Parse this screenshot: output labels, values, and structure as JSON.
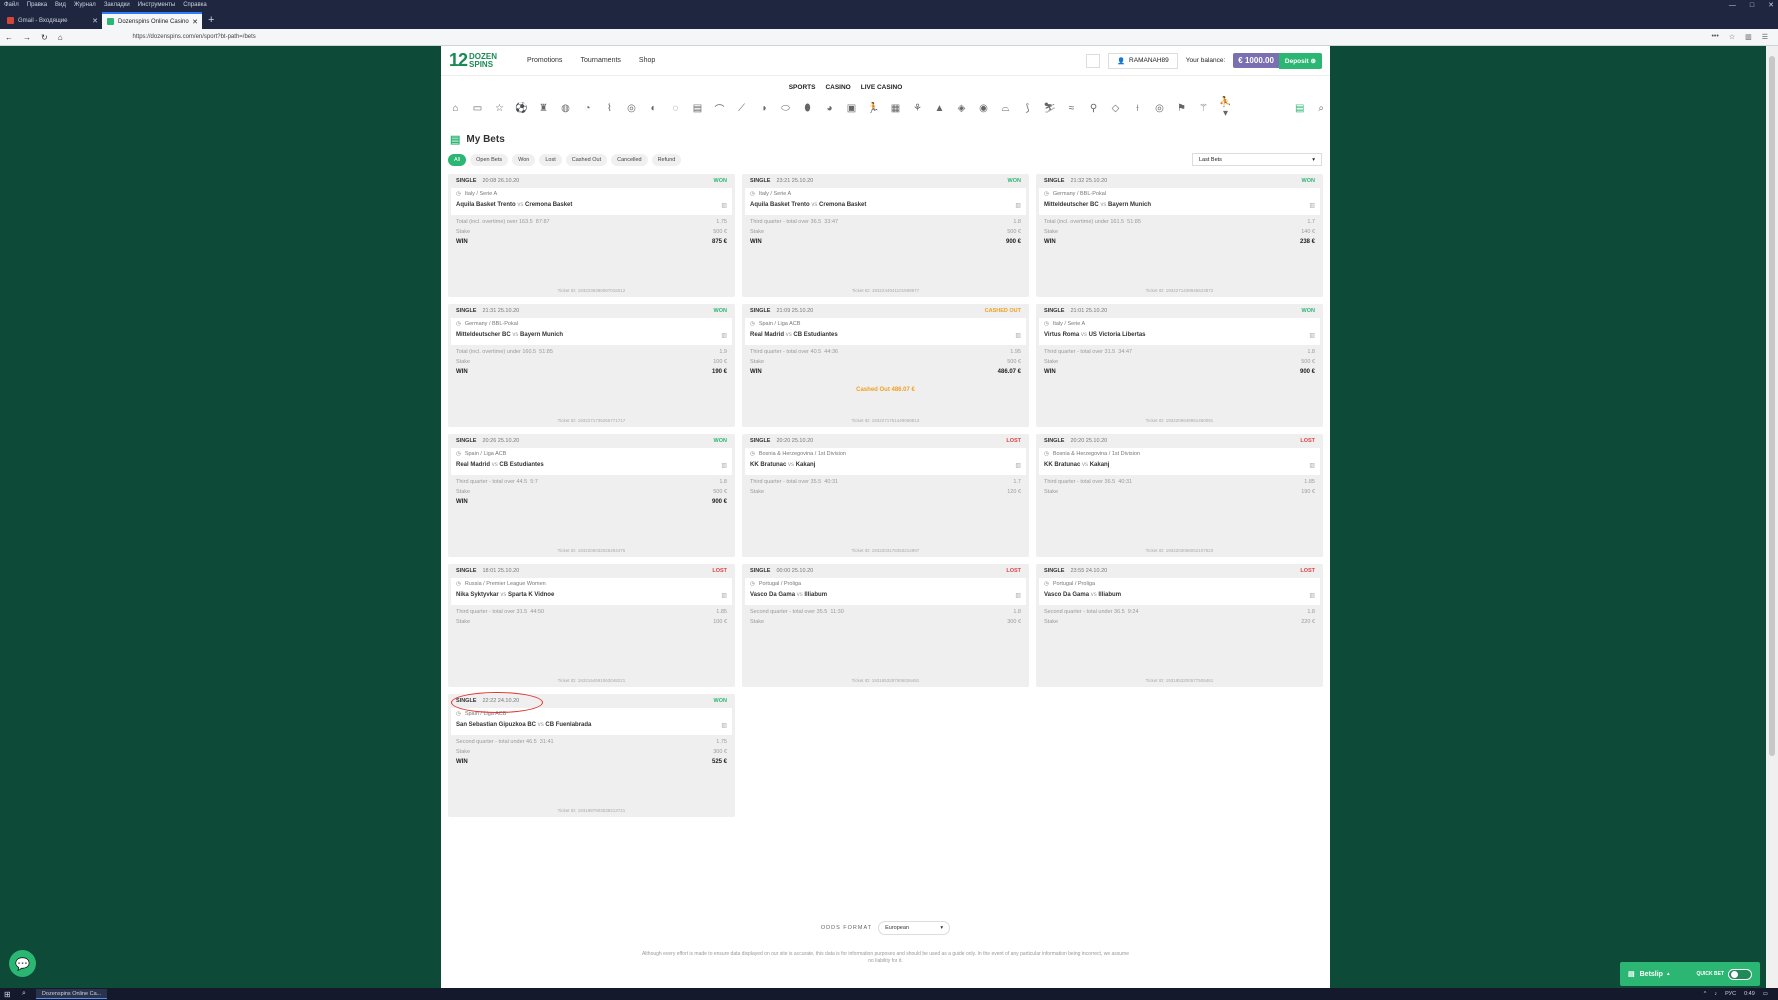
{
  "os": {
    "menu": [
      "Файл",
      "Правка",
      "Вид",
      "Журнал",
      "Закладки",
      "Инструменты",
      "Справка"
    ]
  },
  "browser": {
    "tabs": [
      {
        "label": "Gmail - Входящие",
        "active": false
      },
      {
        "label": "Dozenspins Online Casino",
        "active": true
      }
    ],
    "url": "https://dozenspins.com/en/sport?bt-path=/bets"
  },
  "site": {
    "logo_num": "12",
    "logo_word1": "DOZEN",
    "logo_word2": "SPINS",
    "nav": [
      "Promotions",
      "Tournaments",
      "Shop"
    ],
    "username": "RAMANAH89",
    "balance_label": "Your balance:",
    "balance": "€ 1000.00",
    "deposit": "Deposit"
  },
  "main_tabs": [
    "SPORTS",
    "CASINO",
    "LIVE CASINO"
  ],
  "page_title": "My Bets",
  "filters": [
    "All",
    "Open Bets",
    "Won",
    "Lost",
    "Cashed Out",
    "Cancelled",
    "Refund"
  ],
  "sort_select": "Last Bets",
  "bets": [
    {
      "kind": "SINGLE",
      "time": "20:08 26.10.20",
      "status": "WON",
      "league": "Italy / Serie A",
      "home": "Aquila Basket Trento",
      "away": "Cremona Basket",
      "market": "Total (incl. overtime) over 163.5",
      "stat": "87:87",
      "odds": "1.75",
      "stake_label": "Stake",
      "stake": "500 €",
      "win_label": "WIN",
      "win": "875 €",
      "ticket": "Ticket ID: 1932236380097016012",
      "cash": ""
    },
    {
      "kind": "SINGLE",
      "time": "23:21 25.10.20",
      "status": "WON",
      "league": "Italy / Serie A",
      "home": "Aquila Basket Trento",
      "away": "Cremona Basket",
      "market": "Third quarter - total over 36.5",
      "stat": "33:47",
      "odds": "1.8",
      "stake_label": "Stake",
      "stake": "500 €",
      "win_label": "WIN",
      "win": "900 €",
      "ticket": "Ticket ID: 1932244041101599977",
      "cash": ""
    },
    {
      "kind": "SINGLE",
      "time": "21:32 25.10.20",
      "status": "WON",
      "league": "Germany / BBL-Pokal",
      "home": "Mitteldeutscher BC",
      "away": "Bayern Munich",
      "market": "Total (incl. overtime) under 161.5",
      "stat": "51:85",
      "odds": "1.7",
      "stake_label": "Stake",
      "stake": "140 €",
      "win_label": "WIN",
      "win": "238 €",
      "ticket": "Ticket ID: 1932271439945523872",
      "cash": ""
    },
    {
      "kind": "SINGLE",
      "time": "21:31 25.10.20",
      "status": "WON",
      "league": "Germany / BBL-Pokal",
      "home": "Mitteldeutscher BC",
      "away": "Bayern Munich",
      "market": "Total (incl. overtime) under 160.5",
      "stat": "51:85",
      "odds": "1.9",
      "stake_label": "Stake",
      "stake": "100 €",
      "win_label": "WIN",
      "win": "190 €",
      "ticket": "Ticket ID: 1932271735266771717",
      "cash": ""
    },
    {
      "kind": "SINGLE",
      "time": "21:09 25.10.20",
      "status": "CASHED OUT",
      "league": "Spain / Liga ACB",
      "home": "Real Madrid",
      "away": "CB Estudiantes",
      "market": "Third quarter - total over 40.5",
      "stat": "44:36",
      "odds": "1.95",
      "stake_label": "Stake",
      "stake": "500 €",
      "win_label": "WIN",
      "win": "486.07 €",
      "ticket": "Ticket ID: 1932271751449069813",
      "cash": "Cashed Out 486.07 €"
    },
    {
      "kind": "SINGLE",
      "time": "21:01 25.10.20",
      "status": "WON",
      "league": "Italy / Serie A",
      "home": "Virtus Roma",
      "away": "US Victoria Libertas",
      "market": "Third quarter - total over 31.5",
      "stat": "34:47",
      "odds": "1.8",
      "stake_label": "Stake",
      "stake": "500 €",
      "win_label": "WIN",
      "win": "900 €",
      "ticket": "Ticket ID: 1932209649961460091",
      "cash": ""
    },
    {
      "kind": "SINGLE",
      "time": "20:26 25.10.20",
      "status": "WON",
      "league": "Spain / Liga ACB",
      "home": "Real Madrid",
      "away": "CB Estudiantes",
      "market": "Third quarter - total over 44.5",
      "stat": "5:7",
      "odds": "1.8",
      "stake_label": "Stake",
      "stake": "500 €",
      "win_label": "WIN",
      "win": "900 €",
      "ticket": "Ticket ID: 1932205032025494475",
      "cash": ""
    },
    {
      "kind": "SINGLE",
      "time": "20:20 25.10.20",
      "status": "LOST",
      "league": "Bosnia & Herzegovina / 1st Division",
      "home": "KK Bratunac",
      "away": "Kakanj",
      "market": "Third quarter - total over 35.5",
      "stat": "40:31",
      "odds": "1.7",
      "stake_label": "Stake",
      "stake": "120 €",
      "win_label": "",
      "win": "",
      "ticket": "Ticket ID: 1932203178353214997",
      "cash": ""
    },
    {
      "kind": "SINGLE",
      "time": "20:20 25.10.20",
      "status": "LOST",
      "league": "Bosnia & Herzegovina / 1st Division",
      "home": "KK Bratunac",
      "away": "Kakanj",
      "market": "Third quarter - total over 36.5",
      "stat": "40:31",
      "odds": "1.85",
      "stake_label": "Stake",
      "stake": "190 €",
      "win_label": "",
      "win": "",
      "ticket": "Ticket ID: 1932203066052107623",
      "cash": ""
    },
    {
      "kind": "SINGLE",
      "time": "18:01 25.10.20",
      "status": "LOST",
      "league": "Russia / Premier League Women",
      "home": "Nika Syktyvkar",
      "away": "Sparta K Vidnoe",
      "market": "Third quarter - total over 31.5",
      "stat": "44:50",
      "odds": "1.85",
      "stake_label": "Stake",
      "stake": "100 €",
      "win_label": "",
      "win": "",
      "ticket": "Ticket ID: 1932164591063048221",
      "cash": ""
    },
    {
      "kind": "SINGLE",
      "time": "00:00 25.10.20",
      "status": "LOST",
      "league": "Portugal / Proliga",
      "home": "Vasco Da Gama",
      "away": "Illiabum",
      "market": "Second quarter - total over 35.5",
      "stat": "11:30",
      "odds": "1.8",
      "stake_label": "Stake",
      "stake": "300 €",
      "win_label": "",
      "win": "",
      "ticket": "Ticket ID: 1931853287806026491",
      "cash": ""
    },
    {
      "kind": "SINGLE",
      "time": "23:55 24.10.20",
      "status": "LOST",
      "league": "Portugal / Proliga",
      "home": "Vasco Da Gama",
      "away": "Illiabum",
      "market": "Second quarter - total under 36.5",
      "stat": "9:24",
      "odds": "1.8",
      "stake_label": "Stake",
      "stake": "220 €",
      "win_label": "",
      "win": "",
      "ticket": "Ticket ID: 1931853200577505481",
      "cash": ""
    },
    {
      "kind": "SINGLE",
      "time": "22:22 24.10.20",
      "status": "WON",
      "league": "Spain / Liga ACB",
      "home": "San Sebastian Gipuzkoa BC",
      "away": "CB Fuenlabrada",
      "market": "Second quarter - total under 46.5",
      "stat": "31:41",
      "odds": "1.75",
      "stake_label": "Stake",
      "stake": "300 €",
      "win_label": "WIN",
      "win": "525 €",
      "ticket": "Ticket ID: 1931887903038213721",
      "cash": ""
    }
  ],
  "vs": "vs",
  "odds_format_label": "ODDS FORMAT",
  "odds_format_value": "European",
  "disclaimer": "Although every effort is made to ensure data displayed on our site is accurate, this data is for information purposes and should be used as a guide only. In the event of any particular information being incorrect, we assume no liability for it.",
  "betslip": {
    "label": "Betslip",
    "quick_bet": "QUICK BET"
  },
  "taskbar": {
    "app": "Dozenspins Online Ca...",
    "lang": "РУС",
    "time": "0:49"
  }
}
